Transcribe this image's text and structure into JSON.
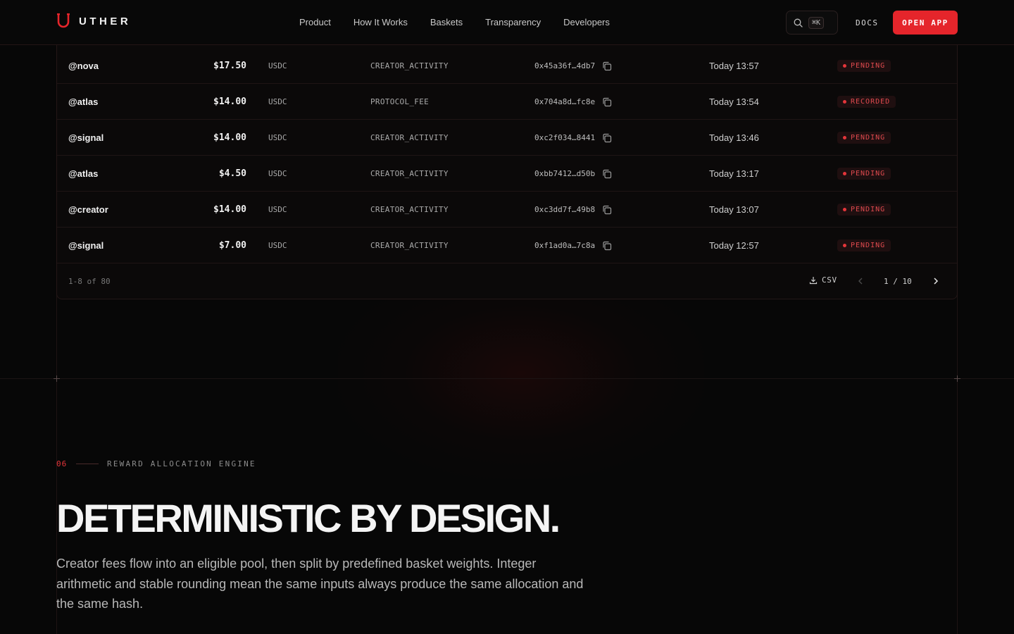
{
  "header": {
    "brand": "UTHER",
    "nav": [
      "Product",
      "How It Works",
      "Baskets",
      "Transparency",
      "Developers"
    ],
    "search_shortcut": "⌘K",
    "docs_label": "DOCS",
    "open_app_label": "OPEN APP",
    "accent_color": "#e5252b"
  },
  "table": {
    "rows": [
      {
        "user": "@nova",
        "amount": "$17.50",
        "asset": "USDC",
        "type": "CREATOR_ACTIVITY",
        "hash": "0x45a36f…4db7",
        "time": "Today 13:57",
        "status": "PENDING"
      },
      {
        "user": "@atlas",
        "amount": "$14.00",
        "asset": "USDC",
        "type": "PROTOCOL_FEE",
        "hash": "0x704a8d…fc8e",
        "time": "Today 13:54",
        "status": "RECORDED"
      },
      {
        "user": "@signal",
        "amount": "$14.00",
        "asset": "USDC",
        "type": "CREATOR_ACTIVITY",
        "hash": "0xc2f034…8441",
        "time": "Today 13:46",
        "status": "PENDING"
      },
      {
        "user": "@atlas",
        "amount": "$4.50",
        "asset": "USDC",
        "type": "CREATOR_ACTIVITY",
        "hash": "0xbb7412…d50b",
        "time": "Today 13:17",
        "status": "PENDING"
      },
      {
        "user": "@creator",
        "amount": "$14.00",
        "asset": "USDC",
        "type": "CREATOR_ACTIVITY",
        "hash": "0xc3dd7f…49b8",
        "time": "Today 13:07",
        "status": "PENDING"
      },
      {
        "user": "@signal",
        "amount": "$7.00",
        "asset": "USDC",
        "type": "CREATOR_ACTIVITY",
        "hash": "0xf1ad0a…7c8a",
        "time": "Today 12:57",
        "status": "PENDING"
      }
    ],
    "footer": {
      "range": "1-8 of 80",
      "csv_label": "CSV",
      "page_current": "1",
      "page_separator": "/",
      "page_total": "10"
    }
  },
  "section": {
    "number": "06",
    "label": "REWARD ALLOCATION ENGINE",
    "headline": "DETERMINISTIC BY DESIGN.",
    "body": "Creator fees flow into an eligible pool, then split by predefined basket weights. Integer arithmetic and stable rounding mean the same inputs always produce the same allocation and the same hash."
  }
}
